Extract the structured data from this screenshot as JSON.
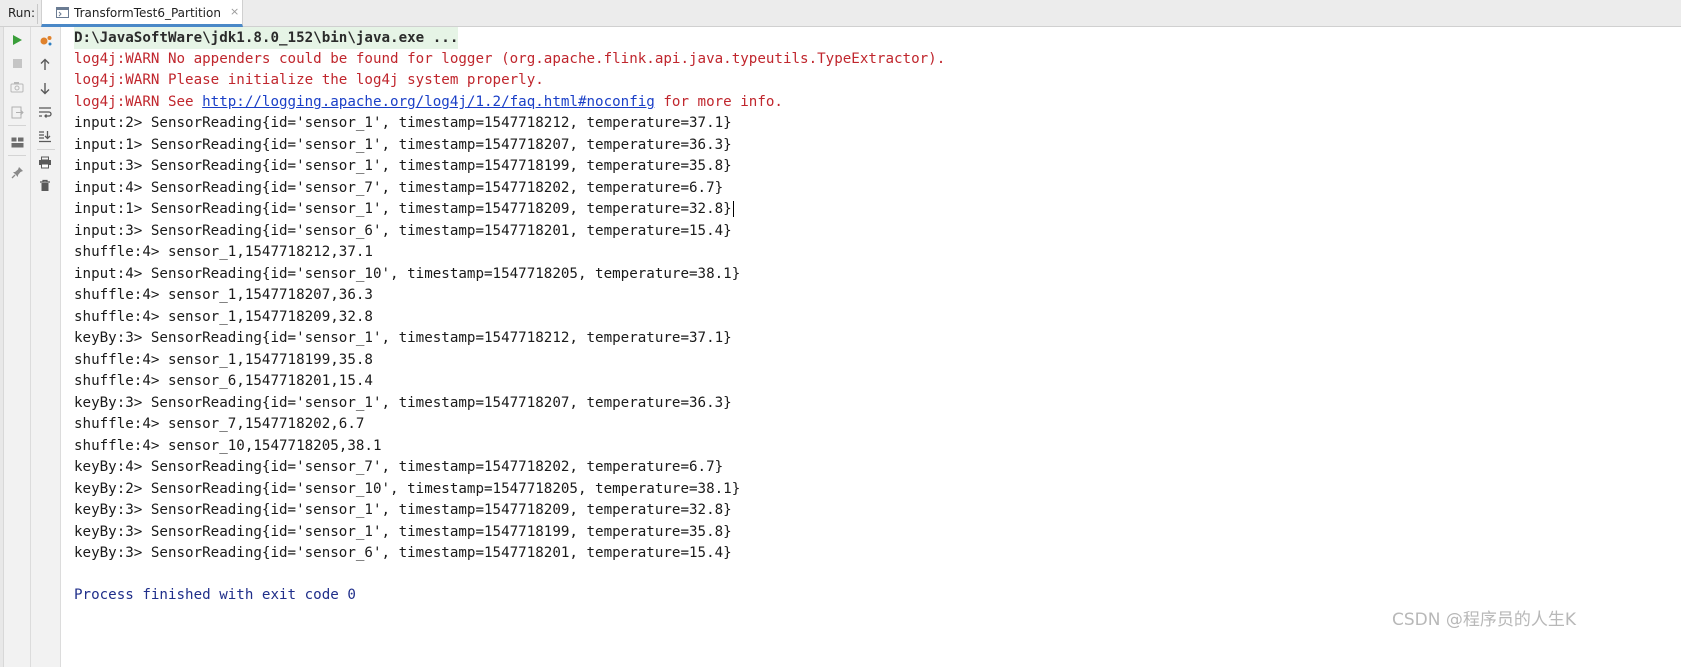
{
  "run_label": "Run:",
  "tab": {
    "title": "TransformTest6_Partition",
    "close": "×"
  },
  "console": {
    "command": "D:\\JavaSoftWare\\jdk1.8.0_152\\bin\\java.exe ...",
    "warnings": [
      "log4j:WARN No appenders could be found for logger (org.apache.flink.api.java.typeutils.TypeExtractor).",
      "log4j:WARN Please initialize the log4j system properly."
    ],
    "warn_see": {
      "prefix": "log4j:WARN See ",
      "url": "http://logging.apache.org/log4j/1.2/faq.html#noconfig",
      "suffix": " for more info."
    },
    "output_lines": [
      "input:2> SensorReading{id='sensor_1', timestamp=1547718212, temperature=37.1}",
      "input:1> SensorReading{id='sensor_1', timestamp=1547718207, temperature=36.3}",
      "input:3> SensorReading{id='sensor_1', timestamp=1547718199, temperature=35.8}",
      "input:4> SensorReading{id='sensor_7', timestamp=1547718202, temperature=6.7}",
      "input:1> SensorReading{id='sensor_1', timestamp=1547718209, temperature=32.8}",
      "input:3> SensorReading{id='sensor_6', timestamp=1547718201, temperature=15.4}",
      "shuffle:4> sensor_1,1547718212,37.1",
      "input:4> SensorReading{id='sensor_10', timestamp=1547718205, temperature=38.1}",
      "shuffle:4> sensor_1,1547718207,36.3",
      "shuffle:4> sensor_1,1547718209,32.8",
      "keyBy:3> SensorReading{id='sensor_1', timestamp=1547718212, temperature=37.1}",
      "shuffle:4> sensor_1,1547718199,35.8",
      "shuffle:4> sensor_6,1547718201,15.4",
      "keyBy:3> SensorReading{id='sensor_1', timestamp=1547718207, temperature=36.3}",
      "shuffle:4> sensor_7,1547718202,6.7",
      "shuffle:4> sensor_10,1547718205,38.1",
      "keyBy:4> SensorReading{id='sensor_7', timestamp=1547718202, temperature=6.7}",
      "keyBy:2> SensorReading{id='sensor_10', timestamp=1547718205, temperature=38.1}",
      "keyBy:3> SensorReading{id='sensor_1', timestamp=1547718209, temperature=32.8}",
      "keyBy:3> SensorReading{id='sensor_1', timestamp=1547718199, temperature=35.8}",
      "keyBy:3> SensorReading{id='sensor_6', timestamp=1547718201, temperature=15.4}"
    ],
    "exit_message": "Process finished with exit code 0"
  },
  "watermark": "CSDN @程序员的人生K",
  "icons": {
    "left_toolbar": [
      "run-icon",
      "stop-icon",
      "camera-icon",
      "exit-icon",
      "layout-icon",
      "pin-icon"
    ],
    "right_toolbar": [
      "debug-icon",
      "up-arrow-icon",
      "down-arrow-icon",
      "soft-wrap-icon",
      "scroll-to-end-icon",
      "print-icon",
      "trash-icon"
    ]
  },
  "colors": {
    "warn": "#c0262d",
    "link": "#1a3fc7",
    "exit": "#1f2e8a",
    "tab_underline": "#4a88c7",
    "run_green": "#3a9e3a"
  }
}
